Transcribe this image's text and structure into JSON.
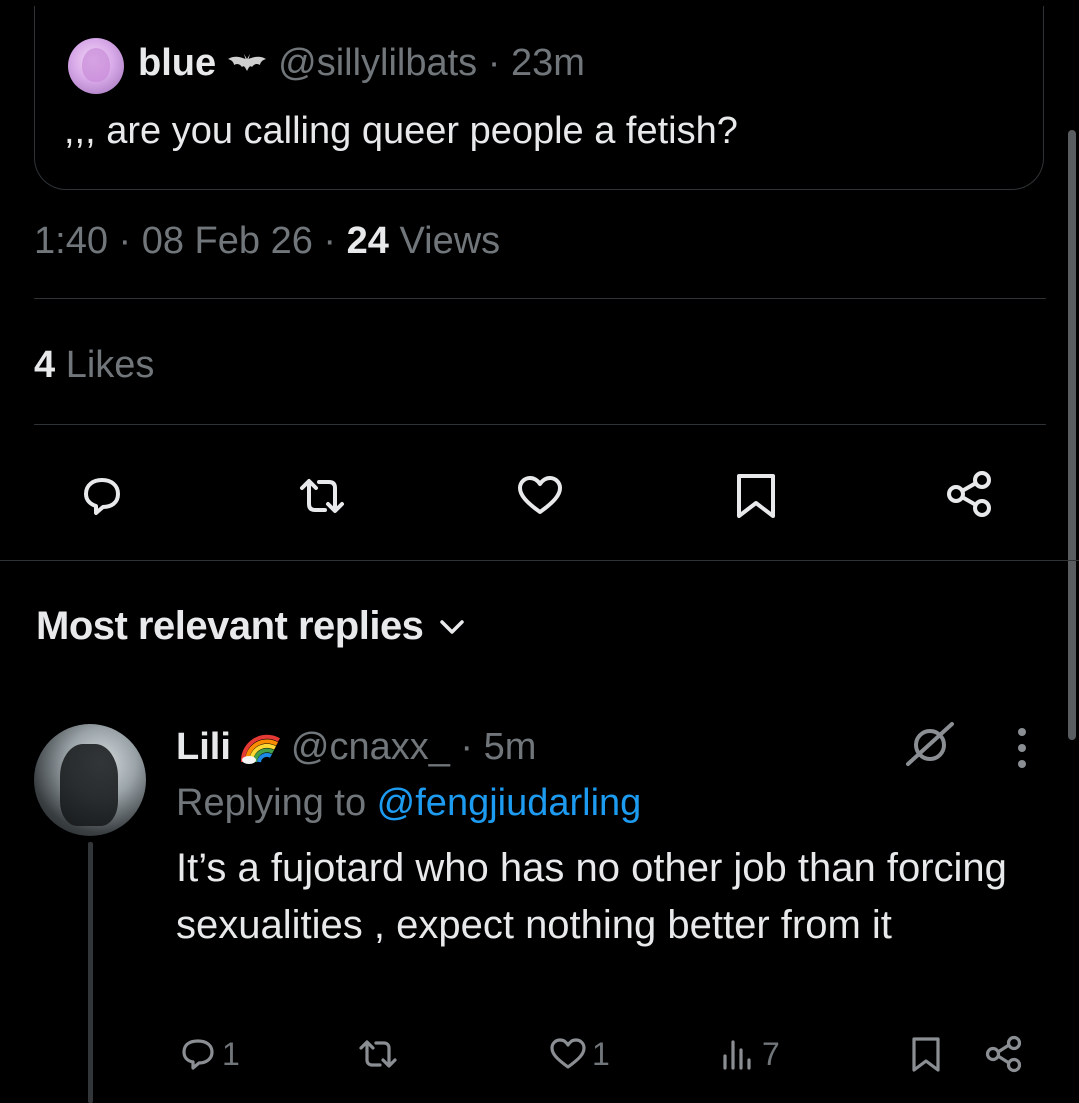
{
  "quoted_tweet": {
    "name": "blue",
    "handle_time": "@sillylilbats · 23m",
    "text": ",,, are you calling queer people a fetish?"
  },
  "post_meta": {
    "time_date": "1:40 · 08 Feb 26 · ",
    "views_count": "24",
    "views_label": " Views"
  },
  "engagement": {
    "likes_count": "4",
    "likes_label": " Likes"
  },
  "replies_section": {
    "sort_label": "Most relevant replies"
  },
  "reply": {
    "name": "Lili",
    "handle_time": "@cnaxx_ · 5m",
    "replying_prefix": "Replying to ",
    "replying_mention": "@fengjiudarling",
    "text": "It’s a fujotard who has no other job than forcing sexualities , expect nothing better from it",
    "reply_count": "1",
    "retweet_count": "",
    "like_count": "1",
    "view_count": "7"
  },
  "colors": {
    "background": "#000000",
    "text": "#e7e9ea",
    "muted": "#71767b",
    "link": "#1d9bf0",
    "border": "#2f3336"
  }
}
